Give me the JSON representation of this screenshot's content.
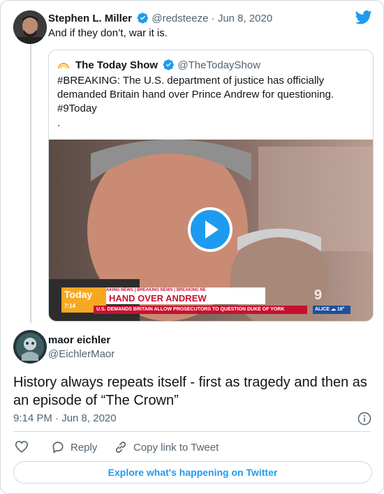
{
  "parent_tweet": {
    "author_name": "Stephen L. Miller",
    "handle": "@redsteeze",
    "date": "Jun 8, 2020",
    "text": "And if they don’t, war it is."
  },
  "quoted_tweet": {
    "author_name": "The Today Show",
    "handle": "@TheTodayShow",
    "text": "#BREAKING: The U.S. department of justice has officially demanded Britain hand over Prince Andrew for questioning. #9Today",
    "trailing": ".",
    "video": {
      "ticker_top": "AKING NEWS | BREAKING NEWS | BREAKING NE",
      "headline": "HAND OVER ANDREW",
      "subheadline": "U.S. DEMANDS BRITAIN ALLOW PROSECUTORS TO QUESTION DUKE OF YORK",
      "show_logo": "Today",
      "time": "7:14",
      "weather": "ALICE ☁ 18°",
      "channel": "9"
    }
  },
  "main_tweet": {
    "author_name": "maor eichler",
    "handle": "@EichlerMaor",
    "text": "History always repeats itself - first as tragedy and then as an episode of “The Crown”",
    "timestamp": "9:14 PM · Jun 8, 2020"
  },
  "actions": {
    "reply": "Reply",
    "copy_link": "Copy link to Tweet"
  },
  "footer": {
    "explore": "Explore what's happening on Twitter"
  },
  "colors": {
    "accent": "#1d9bf0",
    "text": "#0f1419",
    "muted": "#536471",
    "border": "#cfd9de"
  }
}
